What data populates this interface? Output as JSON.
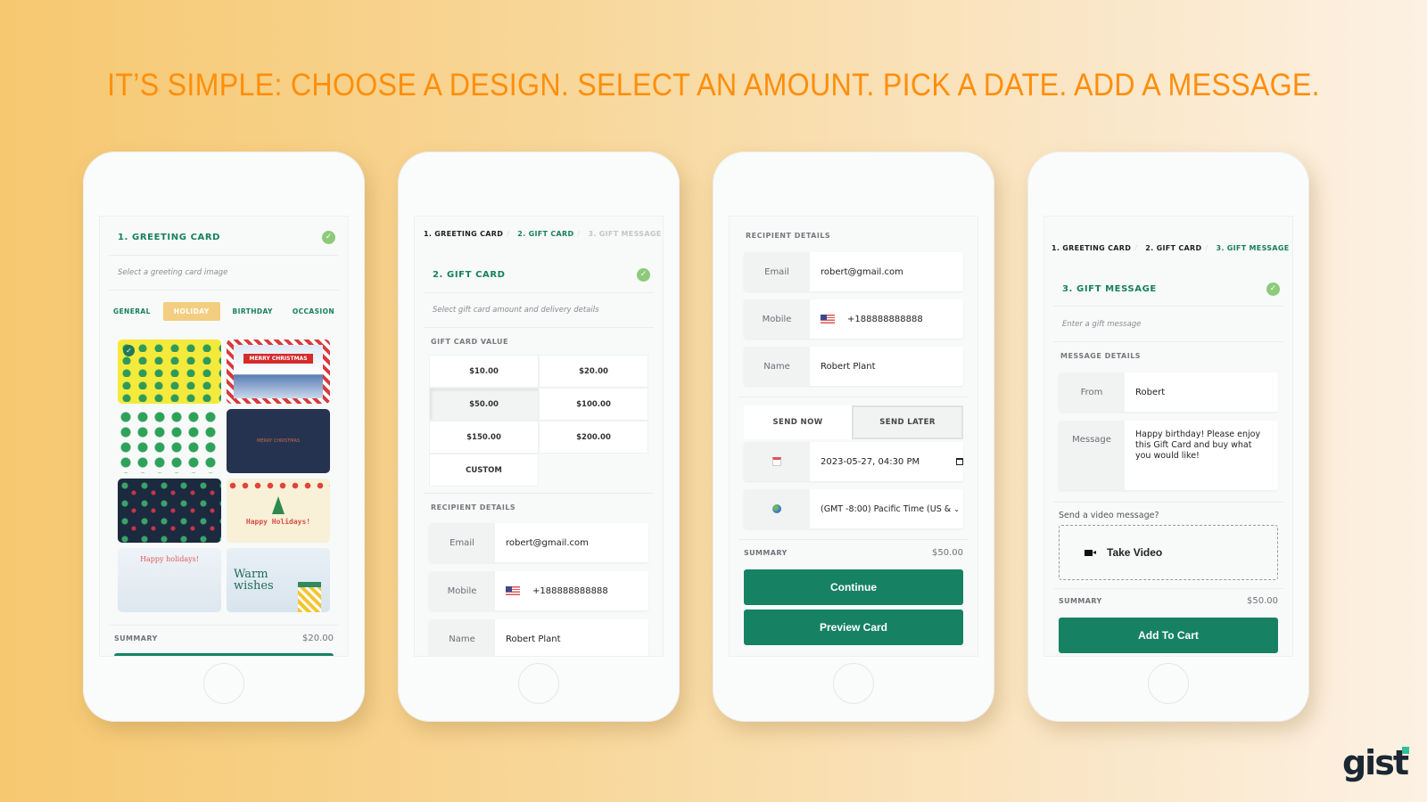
{
  "headline": "IT’S SIMPLE: CHOOSE A DESIGN. SELECT AN AMOUNT. PICK A DATE. ADD A MESSAGE.",
  "brand": {
    "logo": "gist",
    "accent_color": "#2fbf9a"
  },
  "colors": {
    "primary": "#168263",
    "headline": "#ff8e0b",
    "check": "#8dcb7a",
    "active_tab": "#f3ce80"
  },
  "phone1": {
    "section_title": "1. GREETING CARD",
    "subtitle": "Select a greeting card image",
    "tabs": [
      {
        "label": "GENERAL",
        "active": false
      },
      {
        "label": "HOLIDAY",
        "active": true
      },
      {
        "label": "BIRTHDAY",
        "active": false
      },
      {
        "label": "OCCASION",
        "active": false
      }
    ],
    "cards": [
      {
        "name": "christmas-trees-yellow",
        "selected": true,
        "text": ""
      },
      {
        "name": "merry-christmas-banner",
        "selected": false,
        "text": "MERRY CHRISTMAS"
      },
      {
        "name": "tree-pattern-white",
        "selected": false,
        "text": ""
      },
      {
        "name": "holly-dark",
        "selected": false,
        "text": "MERRY CHRISTMAS"
      },
      {
        "name": "tree-pattern-navy",
        "selected": false,
        "text": ""
      },
      {
        "name": "happy-holidays-lights",
        "selected": false,
        "text": "Happy Holidays!"
      },
      {
        "name": "happy-holidays-bear",
        "selected": false,
        "text": "Happy holidays!"
      },
      {
        "name": "warm-wishes",
        "selected": false,
        "text": "Warm wishes"
      }
    ],
    "summary_label": "SUMMARY",
    "summary_value": "$20.00"
  },
  "phone2": {
    "breadcrumbs": [
      {
        "label": "1. GREETING CARD",
        "state": "done"
      },
      {
        "label": "2. GIFT CARD",
        "state": "current"
      },
      {
        "label": "3. GIFT MESSAGE",
        "state": "pending"
      }
    ],
    "section_title": "2. GIFT CARD",
    "subtitle": "Select gift card amount and delivery details",
    "value_label": "GIFT CARD VALUE",
    "amounts": [
      {
        "label": "$10.00",
        "selected": false
      },
      {
        "label": "$20.00",
        "selected": false
      },
      {
        "label": "$50.00",
        "selected": true
      },
      {
        "label": "$100.00",
        "selected": false
      },
      {
        "label": "$150.00",
        "selected": false
      },
      {
        "label": "$200.00",
        "selected": false
      },
      {
        "label": "CUSTOM",
        "selected": false
      }
    ],
    "recipient_label": "RECIPIENT DETAILS",
    "email_label": "Email",
    "email_value": "robert@gmail.com",
    "mobile_label": "Mobile",
    "mobile_value": "+188888888888",
    "name_label": "Name",
    "name_value": "Robert Plant"
  },
  "phone3": {
    "recipient_label": "RECIPIENT DETAILS",
    "email_label": "Email",
    "email_value": "robert@gmail.com",
    "mobile_label": "Mobile",
    "mobile_value": "+188888888888",
    "name_label": "Name",
    "name_value": "Robert Plant",
    "send_now": "SEND NOW",
    "send_later": "SEND LATER",
    "send_mode": "later",
    "datetime_value": "2023-05-27, 04:30 PM",
    "timezone_value": "(GMT -8:00) Pacific Time (US &",
    "summary_label": "SUMMARY",
    "summary_value": "$50.00",
    "continue_label": "Continue",
    "preview_label": "Preview Card"
  },
  "phone4": {
    "breadcrumbs": [
      {
        "label": "1. GREETING CARD",
        "state": "done"
      },
      {
        "label": "2. GIFT CARD",
        "state": "done"
      },
      {
        "label": "3. GIFT MESSAGE",
        "state": "current"
      }
    ],
    "section_title": "3. GIFT MESSAGE",
    "subtitle": "Enter a gift message",
    "details_label": "MESSAGE DETAILS",
    "from_label": "From",
    "from_value": "Robert",
    "message_label": "Message",
    "message_value": "Happy birthday! Please enjoy this Gift Card and buy what you would like!",
    "video_prompt": "Send a video message?",
    "video_button": "Take Video",
    "summary_label": "SUMMARY",
    "summary_value": "$50.00",
    "add_to_cart_label": "Add To Cart"
  }
}
